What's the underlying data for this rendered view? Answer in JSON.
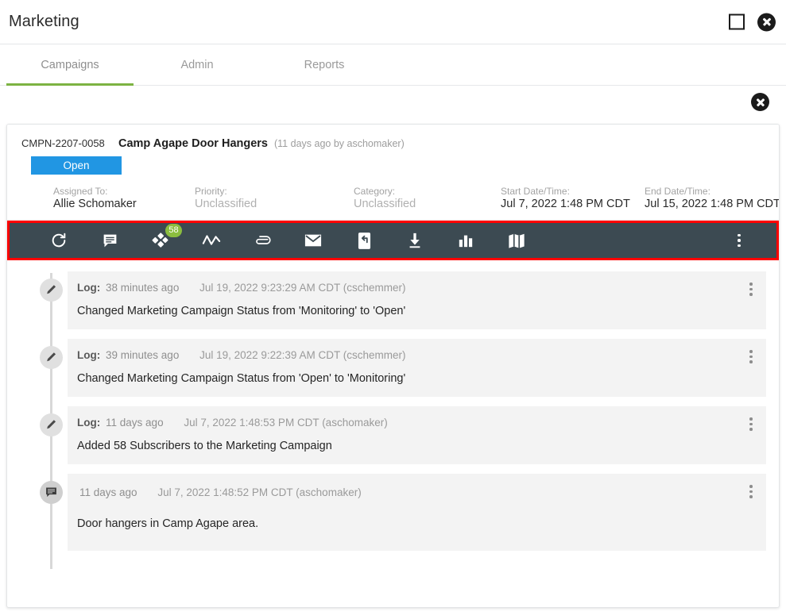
{
  "window": {
    "title": "Marketing",
    "maximize_icon": "maximize-square-icon",
    "close_icon": "close-circle-icon"
  },
  "tabs": [
    {
      "label": "Campaigns",
      "active": true
    },
    {
      "label": "Admin",
      "active": false
    },
    {
      "label": "Reports",
      "active": false
    }
  ],
  "colors": {
    "tab_active_underline": "#7cb342",
    "status_badge": "#2196e3",
    "toolbar_background": "#3c4a52",
    "toolbar_highlight_border": "#ff0000",
    "count_badge": "#8bbd3f",
    "entry_background": "#f3f3f3"
  },
  "campaign": {
    "id": "CMPN-2207-0058",
    "name": "Camp Agape Door Hangers",
    "meta": "(11 days ago by aschomaker)",
    "status": "Open",
    "fields": [
      {
        "label": "Assigned To:",
        "value": "Allie Schomaker",
        "muted": false
      },
      {
        "label": "Priority:",
        "value": "Unclassified",
        "muted": true
      },
      {
        "label": "Category:",
        "value": "Unclassified",
        "muted": true
      },
      {
        "label": "Start Date/Time:",
        "value": "Jul 7, 2022 1:48 PM CDT",
        "muted": false
      },
      {
        "label": "End Date/Time:",
        "value": "Jul 15, 2022 1:48 PM CDT",
        "muted": false
      }
    ]
  },
  "toolbar": {
    "highlighted": true,
    "buttons": [
      {
        "icon": "refresh-icon",
        "badge": null
      },
      {
        "icon": "comment-icon",
        "badge": null
      },
      {
        "icon": "subscribers-icon",
        "badge": "58"
      },
      {
        "icon": "activity-line-chart-icon",
        "badge": null
      },
      {
        "icon": "paperclip-attachment-icon",
        "badge": null
      },
      {
        "icon": "envelope-email-icon",
        "badge": null
      },
      {
        "icon": "mobile-sms-icon",
        "badge": null
      },
      {
        "icon": "download-icon",
        "badge": null
      },
      {
        "icon": "bar-chart-icon",
        "badge": null
      },
      {
        "icon": "map-icon",
        "badge": null
      }
    ],
    "overflow_icon": "more-vertical-icon"
  },
  "timeline": {
    "entries": [
      {
        "icon": "pencil-edit-icon",
        "prefix": "Log:",
        "ago": "38 minutes ago",
        "timestamp": "Jul 19, 2022 9:23:29 AM CDT (cschemmer)",
        "text": "Changed Marketing Campaign Status from 'Monitoring' to 'Open'"
      },
      {
        "icon": "pencil-edit-icon",
        "prefix": "Log:",
        "ago": "39 minutes ago",
        "timestamp": "Jul 19, 2022 9:22:39 AM CDT (cschemmer)",
        "text": "Changed Marketing Campaign Status from 'Open' to 'Monitoring'"
      },
      {
        "icon": "pencil-edit-icon",
        "prefix": "Log:",
        "ago": "11 days ago",
        "timestamp": "Jul 7, 2022 1:48:53 PM CDT (aschomaker)",
        "text": "Added 58 Subscribers to the Marketing Campaign"
      },
      {
        "icon": "comment-note-icon",
        "prefix": "",
        "ago": "11 days ago",
        "timestamp": "Jul 7, 2022 1:48:52 PM CDT (aschomaker)",
        "text": "Door hangers in Camp Agape area."
      }
    ]
  }
}
